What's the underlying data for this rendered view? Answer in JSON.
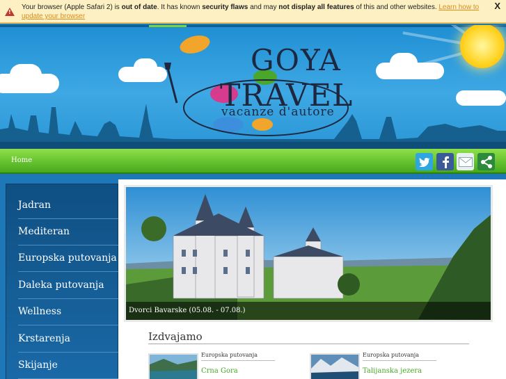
{
  "warning": {
    "text_1": "Your browser (Apple Safari 2) is ",
    "bold_1": "out of date",
    "text_2": ". It has known ",
    "bold_2": "security flaws",
    "text_3": " and may ",
    "bold_3": "not display all features",
    "text_4": " of this and other websites. ",
    "link": "Learn how to update your browser",
    "close": "X"
  },
  "logo": {
    "line1": "GOYA",
    "line2": "TRAVEL",
    "tagline": "vacanze d'autore"
  },
  "nav": {
    "home": "Home",
    "social": [
      "twitter-icon",
      "facebook-icon",
      "email-icon",
      "share-icon"
    ]
  },
  "sidebar": {
    "items": [
      {
        "label": "Jadran"
      },
      {
        "label": "Mediteran"
      },
      {
        "label": "Europska putovanja"
      },
      {
        "label": "Daleka putovanja"
      },
      {
        "label": "Wellness"
      },
      {
        "label": "Krstarenja"
      },
      {
        "label": "Skijanje"
      }
    ]
  },
  "slider": {
    "caption": "Dvorci Bavarske (05.08. - 07.08.)"
  },
  "featured": {
    "title": "Izdvajamo",
    "cards": [
      {
        "category": "Europska putovanja",
        "title": "Crna Gora"
      },
      {
        "category": "Europska putovanja",
        "title": "Talijanska jezera"
      }
    ]
  },
  "colors": {
    "nav_green": "#46a91c",
    "sidebar_blue": "#0f4f82",
    "link_orange": "#d98b1b",
    "card_title_green": "#4aa72a"
  }
}
